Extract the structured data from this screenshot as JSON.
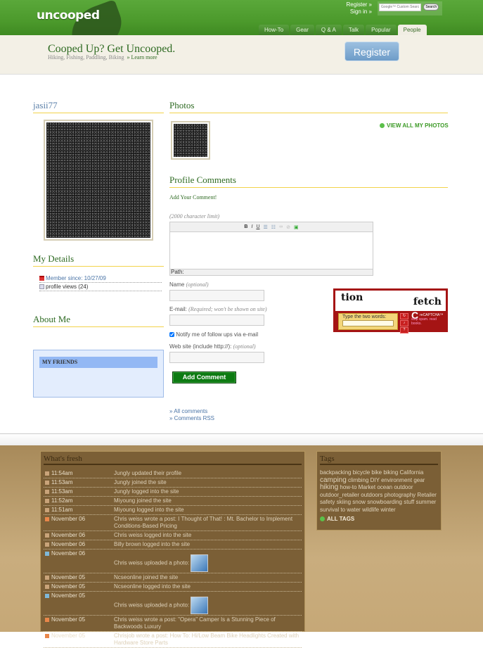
{
  "header": {
    "logo": "uncooped",
    "top_links": [
      "Register »",
      "Sign in »"
    ],
    "search_placeholder": "Google™ Custom Search",
    "search_button": "Search",
    "tabs": [
      {
        "label": "How-To",
        "active": false
      },
      {
        "label": "Gear",
        "active": false
      },
      {
        "label": "Q & A",
        "active": false
      },
      {
        "label": "Talk",
        "active": false
      },
      {
        "label": "Popular",
        "active": false
      },
      {
        "label": "People",
        "active": true
      }
    ]
  },
  "banner": {
    "slogan": "Cooped Up? Get Uncooped.",
    "activities": "Hiking,  Fishing,  Paddling,  Biking",
    "learn_more": "» Learn more",
    "register_button": "Register"
  },
  "profile": {
    "username": "jasii77",
    "my_details_heading": "My Details",
    "member_since": "Member since: 10/27/09",
    "profile_views": "profile views (24)",
    "about_me_heading": "About Me",
    "friends_heading": "MY FRIENDS"
  },
  "photos": {
    "heading": "Photos",
    "view_all": "VIEW ALL MY PHOTOS"
  },
  "comments": {
    "heading": "Profile Comments",
    "add_your_comment": "Add Your Comment!",
    "char_limit": "(2000 character limit)",
    "toolbar": [
      "B",
      "I",
      "U",
      "bullet-list",
      "numbered-list",
      "link",
      "unlink",
      "image"
    ],
    "path_label": "Path:",
    "name_label": "Name",
    "name_hint": "(optional)",
    "name_value": "",
    "email_label": "E-mail:",
    "email_hint": "(Required; won't be shown on site)",
    "email_value": "",
    "notify_label": "Notify me of follow ups via e-mail",
    "notify_checked": true,
    "website_label": "Web site (include http://):",
    "website_hint": "(optional)",
    "website_value": "",
    "submit": "Add Comment",
    "all_comments": "» All comments",
    "comments_rss": "» Comments RSS"
  },
  "captcha": {
    "word1": "tion",
    "word2": "fetch",
    "prompt": "Type the two words:",
    "brand": "reCAPTCHA™",
    "tagline": "stop spam. read books."
  },
  "whats_fresh": {
    "heading": "What's fresh",
    "items": [
      {
        "icon": "user",
        "time": "11:54am",
        "text": "Jungly updated their profile"
      },
      {
        "icon": "user",
        "time": "11:53am",
        "text": "Jungly joined the site"
      },
      {
        "icon": "user",
        "time": "11:53am",
        "text": "Jungly logged into the site"
      },
      {
        "icon": "user",
        "time": "11:52am",
        "text": "Miyoung joined the site"
      },
      {
        "icon": "user",
        "time": "11:51am",
        "text": "Miyoung logged into the site"
      },
      {
        "icon": "post",
        "time": "November 06",
        "text": "Chris weiss wrote a post: I Thought of That! : Mt. Bachelor to Implement Conditions-Based Pricing"
      },
      {
        "icon": "user",
        "time": "November 06",
        "text": "Chris weiss logged into the site"
      },
      {
        "icon": "user",
        "time": "November 06",
        "text": "Billy brown logged into the site"
      },
      {
        "icon": "photo",
        "time": "November 06",
        "text": "Chris weiss uploaded a photo:",
        "has_image": true
      },
      {
        "icon": "user",
        "time": "November 05",
        "text": "Ncseonline joined the site"
      },
      {
        "icon": "user",
        "time": "November 05",
        "text": "Ncseonline logged into the site"
      },
      {
        "icon": "photo",
        "time": "November 05",
        "text": "Chris weiss uploaded a photo:",
        "has_image": true
      },
      {
        "icon": "post",
        "time": "November 05",
        "text": "Chris weiss wrote a post: \"Opera\" Camper Is a Stunning Piece of Backwoods Luxury"
      },
      {
        "icon": "post",
        "time": "November 05",
        "text": "Chrisjob wrote a post: How To: Hi/Low Beam Bike Headlights Created with Hardware Store Parts"
      }
    ]
  },
  "tags": {
    "heading": "Tags",
    "list": [
      {
        "t": "backpacking"
      },
      {
        "t": "bicycle"
      },
      {
        "t": "bike"
      },
      {
        "t": "biking"
      },
      {
        "t": "California"
      },
      {
        "t": "camping",
        "big": true
      },
      {
        "t": "climbing"
      },
      {
        "t": "DIY"
      },
      {
        "t": "environment"
      },
      {
        "t": "gear"
      },
      {
        "t": "hiking",
        "big": true
      },
      {
        "t": "how-to"
      },
      {
        "t": "Market"
      },
      {
        "t": "ocean"
      },
      {
        "t": "outdoor"
      },
      {
        "t": "outdoor_retailer"
      },
      {
        "t": "outdoors"
      },
      {
        "t": "photography"
      },
      {
        "t": "Retailer"
      },
      {
        "t": "safety"
      },
      {
        "t": "skiing"
      },
      {
        "t": "snow"
      },
      {
        "t": "snowboarding"
      },
      {
        "t": "stuff"
      },
      {
        "t": "summer"
      },
      {
        "t": "survival"
      },
      {
        "t": "to"
      },
      {
        "t": "water"
      },
      {
        "t": "wildlife"
      },
      {
        "t": "winter"
      }
    ],
    "all_tags": "ALL TAGS"
  }
}
